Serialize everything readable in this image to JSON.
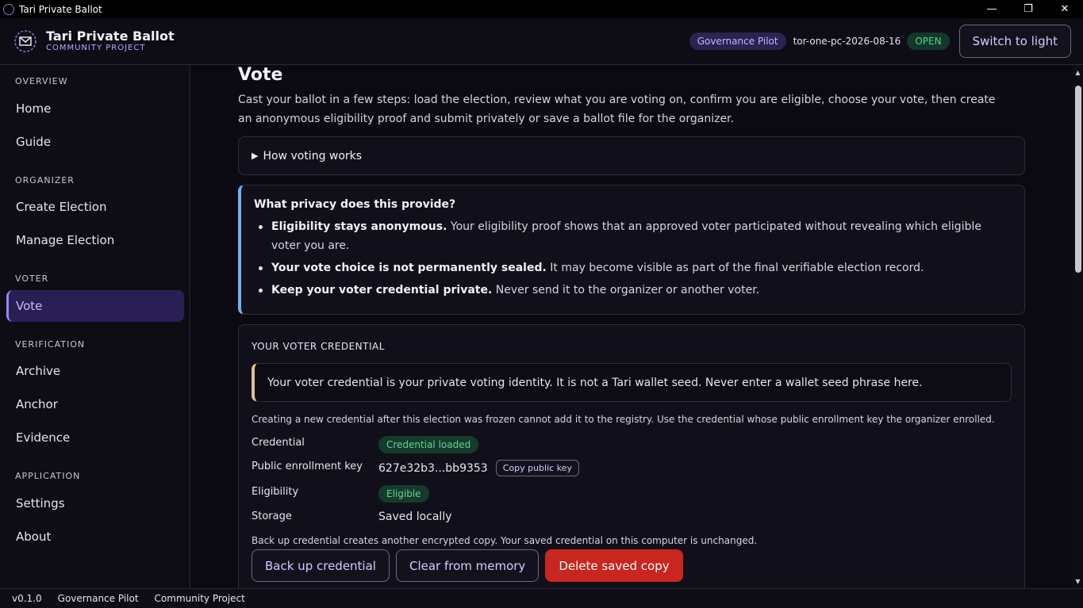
{
  "window": {
    "title": "Tari Private Ballot",
    "minimize": "—",
    "restore": "❐",
    "close": "✕"
  },
  "header": {
    "title": "Tari Private Ballot",
    "subtitle": "COMMUNITY PROJECT",
    "governance_badge": "Governance Pilot",
    "ballot_id": "tor-one-pc-2026-08-16",
    "status_badge": "OPEN",
    "theme_button": "Switch to light",
    "colors": {
      "accent": "#9b83ff",
      "open": "#55d08f"
    }
  },
  "sidebar": {
    "sections": [
      {
        "label": "OVERVIEW",
        "items": [
          "Home",
          "Guide"
        ]
      },
      {
        "label": "ORGANIZER",
        "items": [
          "Create Election",
          "Manage Election"
        ]
      },
      {
        "label": "VOTER",
        "items": [
          "Vote"
        ]
      },
      {
        "label": "VERIFICATION",
        "items": [
          "Archive",
          "Anchor",
          "Evidence"
        ]
      },
      {
        "label": "APPLICATION",
        "items": [
          "Settings",
          "About"
        ]
      }
    ],
    "active": "Vote"
  },
  "main": {
    "title": "Vote",
    "intro": "Cast your ballot in a few steps: load the election, review what you are voting on, confirm you are eligible, choose your vote, then create an anonymous eligibility proof and submit privately or save a ballot file for the organizer.",
    "details_summary": "How voting works",
    "privacy": {
      "heading": "What privacy does this provide?",
      "points": [
        {
          "bold": "Eligibility stays anonymous.",
          "text": " Your eligibility proof shows that an approved voter participated without revealing which eligible voter you are."
        },
        {
          "bold": "Your vote choice is not permanently sealed.",
          "text": " It may become visible as part of the final verifiable election record."
        },
        {
          "bold": "Keep your voter credential private.",
          "text": " Never send it to the organizer or another voter."
        }
      ]
    },
    "credential": {
      "heading": "YOUR VOTER CREDENTIAL",
      "warning": "Your voter credential is your private voting identity. It is not a Tari wallet seed. Never enter a wallet seed phrase here.",
      "note": "Creating a new credential after this election was frozen cannot add it to the registry. Use the credential whose public enrollment key the organizer enrolled.",
      "rows": {
        "credential_label": "Credential",
        "credential_value": "Credential loaded",
        "key_label": "Public enrollment key",
        "key_value": "627e32b3...bb9353",
        "copy_key": "Copy public key",
        "eligibility_label": "Eligibility",
        "eligibility_value": "Eligible",
        "storage_label": "Storage",
        "storage_value": "Saved locally"
      },
      "backup_note": "Back up credential creates another encrypted copy. Your saved credential on this computer is unchanged.",
      "buttons": {
        "backup": "Back up credential",
        "clear": "Clear from memory",
        "delete": "Delete saved copy"
      }
    }
  },
  "footer": {
    "version": "v0.1.0",
    "pilot": "Governance Pilot",
    "project": "Community Project"
  }
}
